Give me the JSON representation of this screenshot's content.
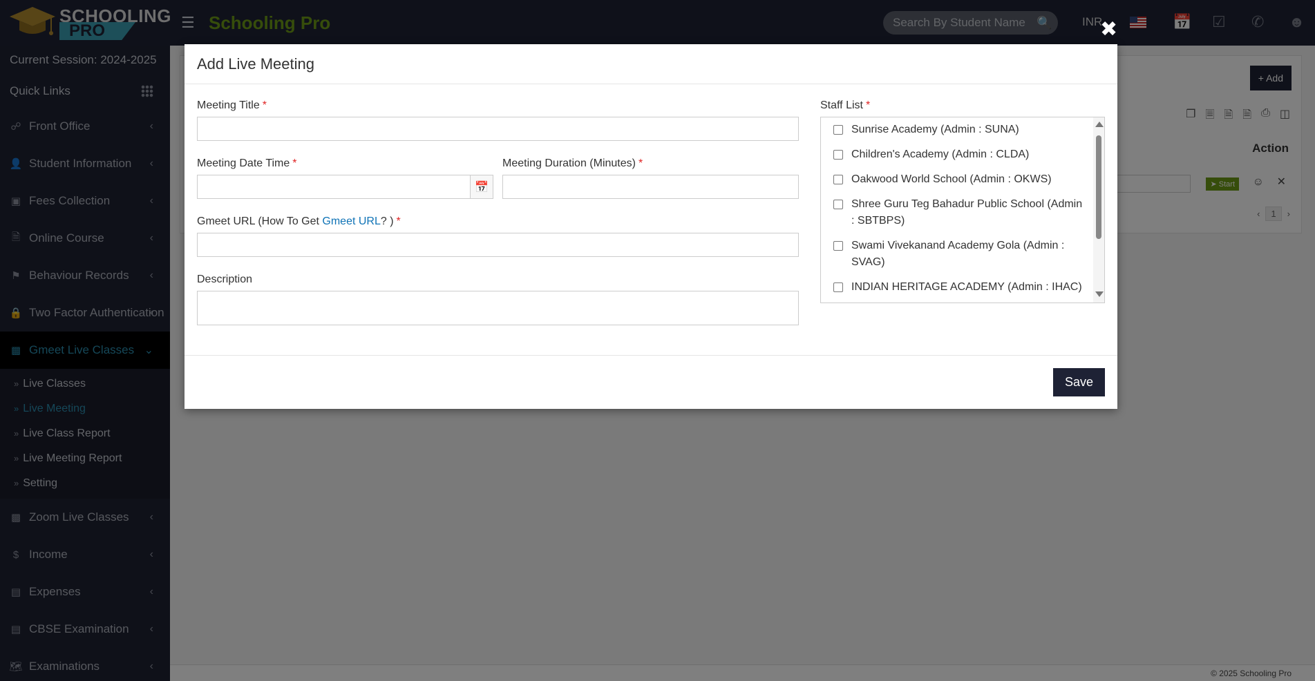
{
  "header": {
    "logo_line1": "SCHOOLING",
    "logo_line2": "PRO",
    "brand": "Schooling Pro",
    "search_placeholder": "Search By Student Name",
    "currency": "INR"
  },
  "sidebar": {
    "session": "Current Session: 2024-2025",
    "quick_links": "Quick Links",
    "items_top": [
      {
        "label": "Front Office",
        "icon": "front-office-icon"
      },
      {
        "label": "Student Information",
        "icon": "student-icon"
      },
      {
        "label": "Fees Collection",
        "icon": "money-icon"
      },
      {
        "label": "Online Course",
        "icon": "course-icon"
      },
      {
        "label": "Behaviour Records",
        "icon": "signpost-icon"
      },
      {
        "label": "Two Factor Authentication",
        "icon": "lock-icon"
      },
      {
        "label": "Gmeet Live Classes",
        "icon": "video-icon"
      }
    ],
    "submenu": [
      "Live Classes",
      "Live Meeting",
      "Live Class Report",
      "Live Meeting Report",
      "Setting"
    ],
    "items_bottom": [
      {
        "label": "Zoom Live Classes",
        "icon": "video-icon"
      },
      {
        "label": "Income",
        "icon": "dollar-icon"
      },
      {
        "label": "Expenses",
        "icon": "card-icon"
      },
      {
        "label": "CBSE Examination",
        "icon": "exam-icon"
      },
      {
        "label": "Examinations",
        "icon": "map-icon"
      }
    ]
  },
  "content": {
    "add_button": "Add",
    "action_header": "Action",
    "start_button": "Start",
    "page_number": "1",
    "footer": "© 2025 Schooling Pro"
  },
  "modal": {
    "title": "Add Live Meeting",
    "meeting_title_label": "Meeting Title",
    "meeting_date_label": "Meeting Date Time",
    "meeting_duration_label": "Meeting Duration (Minutes)",
    "gmeet_url_prefix": "Gmeet URL (How To Get ",
    "gmeet_url_link": "Gmeet URL",
    "gmeet_url_suffix": "? )",
    "description_label": "Description",
    "staff_list_label": "Staff List",
    "required_mark": "*",
    "staff": [
      "Sunrise Academy (Admin : SUNA)",
      "Children's Academy (Admin : CLDA)",
      "Oakwood World School (Admin : OKWS)",
      "Shree Guru Teg Bahadur Public School (Admin : SBTBPS)",
      "Swami Vivekanand Academy Gola (Admin : SVAG)",
      "INDIAN HERITAGE ACADEMY (Admin : IHAC)"
    ],
    "save_label": "Save"
  }
}
